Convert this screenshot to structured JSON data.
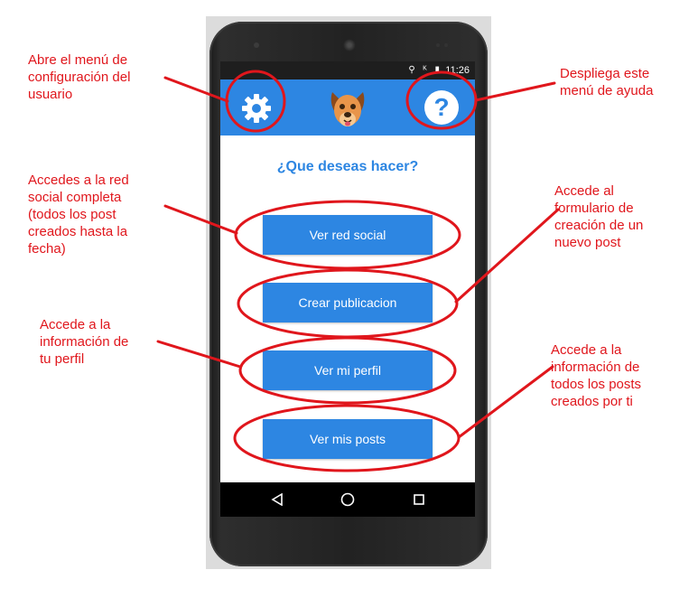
{
  "annotations": {
    "settings": "Abre el menú de\nconfiguración del\nusuario",
    "help": "Despliega este\nmenú de ayuda",
    "social": "Accedes a la red\nsocial completa\n(todos los post\ncreados hasta la\nfecha)",
    "create": "Accede al\nformulario de\ncreación de un\nnuevo post",
    "profile": "Accede a la\ninformación de\ntu perfil",
    "posts": "Accede a la\ninformación de\ntodos los posts\ncreados por ti"
  },
  "status_bar": {
    "icons": "⚲ ᴷ ▮",
    "time": "11:26"
  },
  "app_bar": {
    "settings_icon": "gear-icon",
    "help_icon": "question-icon",
    "help_glyph": "?",
    "logo": "dog-face-logo"
  },
  "main": {
    "question": "¿Que deseas hacer?",
    "buttons": [
      "Ver red social",
      "Crear publicacion",
      "Ver mi perfil",
      "Ver mis posts"
    ]
  },
  "nav_bar": {
    "back_icon": "back-triangle-icon",
    "home_icon": "home-circle-icon",
    "recents_icon": "recents-square-icon"
  },
  "colors": {
    "accent": "#2d86e2",
    "annotation": "#e0161c",
    "status_bar": "#1e1e1e",
    "nav_bar": "#000000"
  }
}
